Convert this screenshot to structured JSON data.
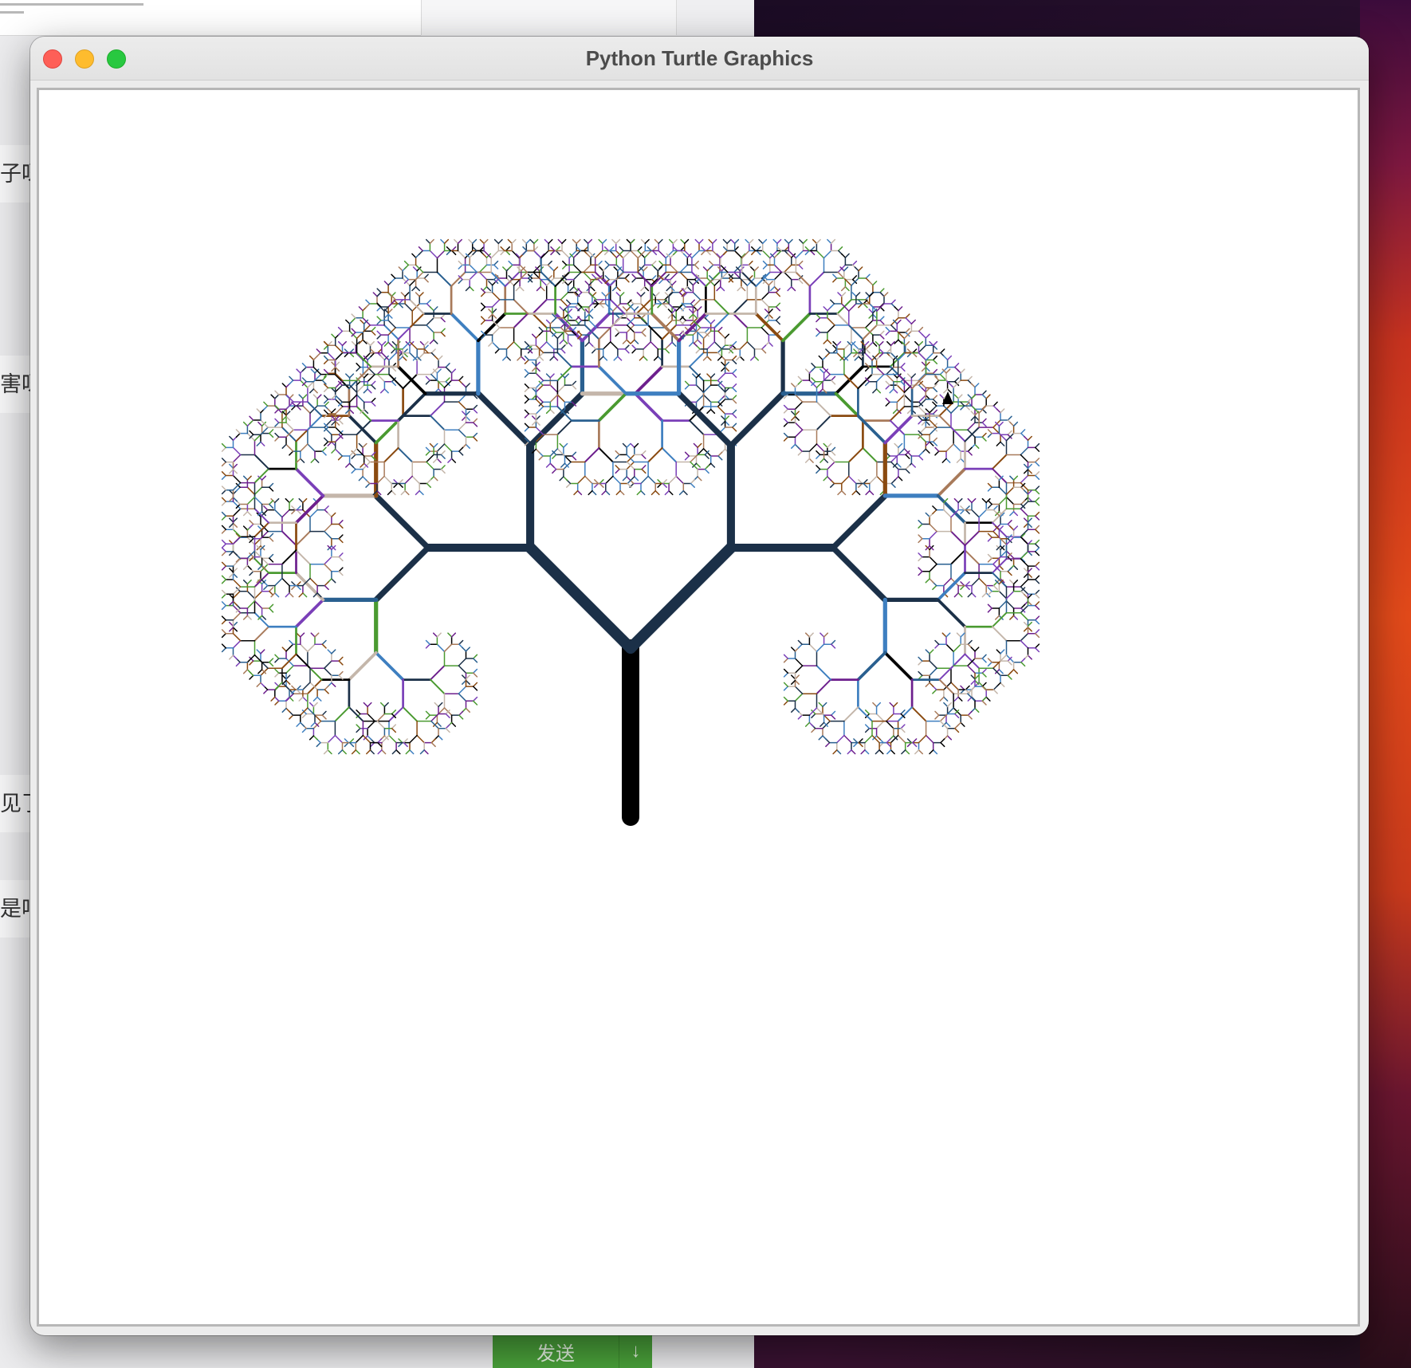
{
  "window": {
    "title": "Python Turtle Graphics",
    "buttons": [
      "close",
      "minimize",
      "maximize"
    ]
  },
  "background": {
    "chat_snippets": [
      "子呀",
      "害呀",
      "见了",
      "是吧"
    ],
    "send_button": {
      "label": "发送",
      "arrow": "↓"
    },
    "icons": [
      "refresh-icon"
    ]
  },
  "drawing": {
    "type": "recursive fractal tree",
    "branch_turn_degrees": 45,
    "palette": [
      "#000000",
      "#1b3048",
      "#6d1f8d",
      "#8a4a10",
      "#4a9a30",
      "#3e7fc0",
      "#a87a5a",
      "#c4b6aa",
      "#7a3fb8",
      "#2a6090"
    ],
    "turtle_cursor": "black arrowhead",
    "colors": {
      "trunk": "#000000",
      "window_bg": "#ececec",
      "canvas_bg": "#ffffff"
    }
  }
}
